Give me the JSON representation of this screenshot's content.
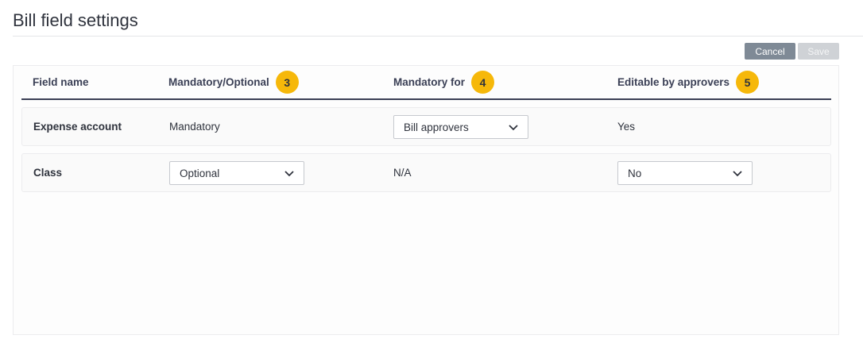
{
  "page": {
    "title": "Bill field settings"
  },
  "toolbar": {
    "cancel_label": "Cancel",
    "save_label": "Save"
  },
  "colors": {
    "badge": "#f6b80a",
    "header_rule": "#3a3f55",
    "cancel_bg": "#7f8a96",
    "save_bg_disabled": "#cfd2d6"
  },
  "table": {
    "headers": {
      "field_name": "Field name",
      "mandatory_optional": "Mandatory/Optional",
      "mandatory_optional_badge": "3",
      "mandatory_for": "Mandatory for",
      "mandatory_for_badge": "4",
      "editable_by_approvers": "Editable by approvers",
      "editable_by_approvers_badge": "5"
    },
    "rows": [
      {
        "field_name": "Expense account",
        "mandatory_optional": "Mandatory",
        "mandatory_for_select": "Bill approvers",
        "editable_by_approvers": "Yes"
      },
      {
        "field_name": "Class",
        "mandatory_optional_select": "Optional",
        "mandatory_for": "N/A",
        "editable_by_approvers_select": "No"
      }
    ]
  },
  "icons": {
    "select_arrow": "chevron-down-icon"
  }
}
